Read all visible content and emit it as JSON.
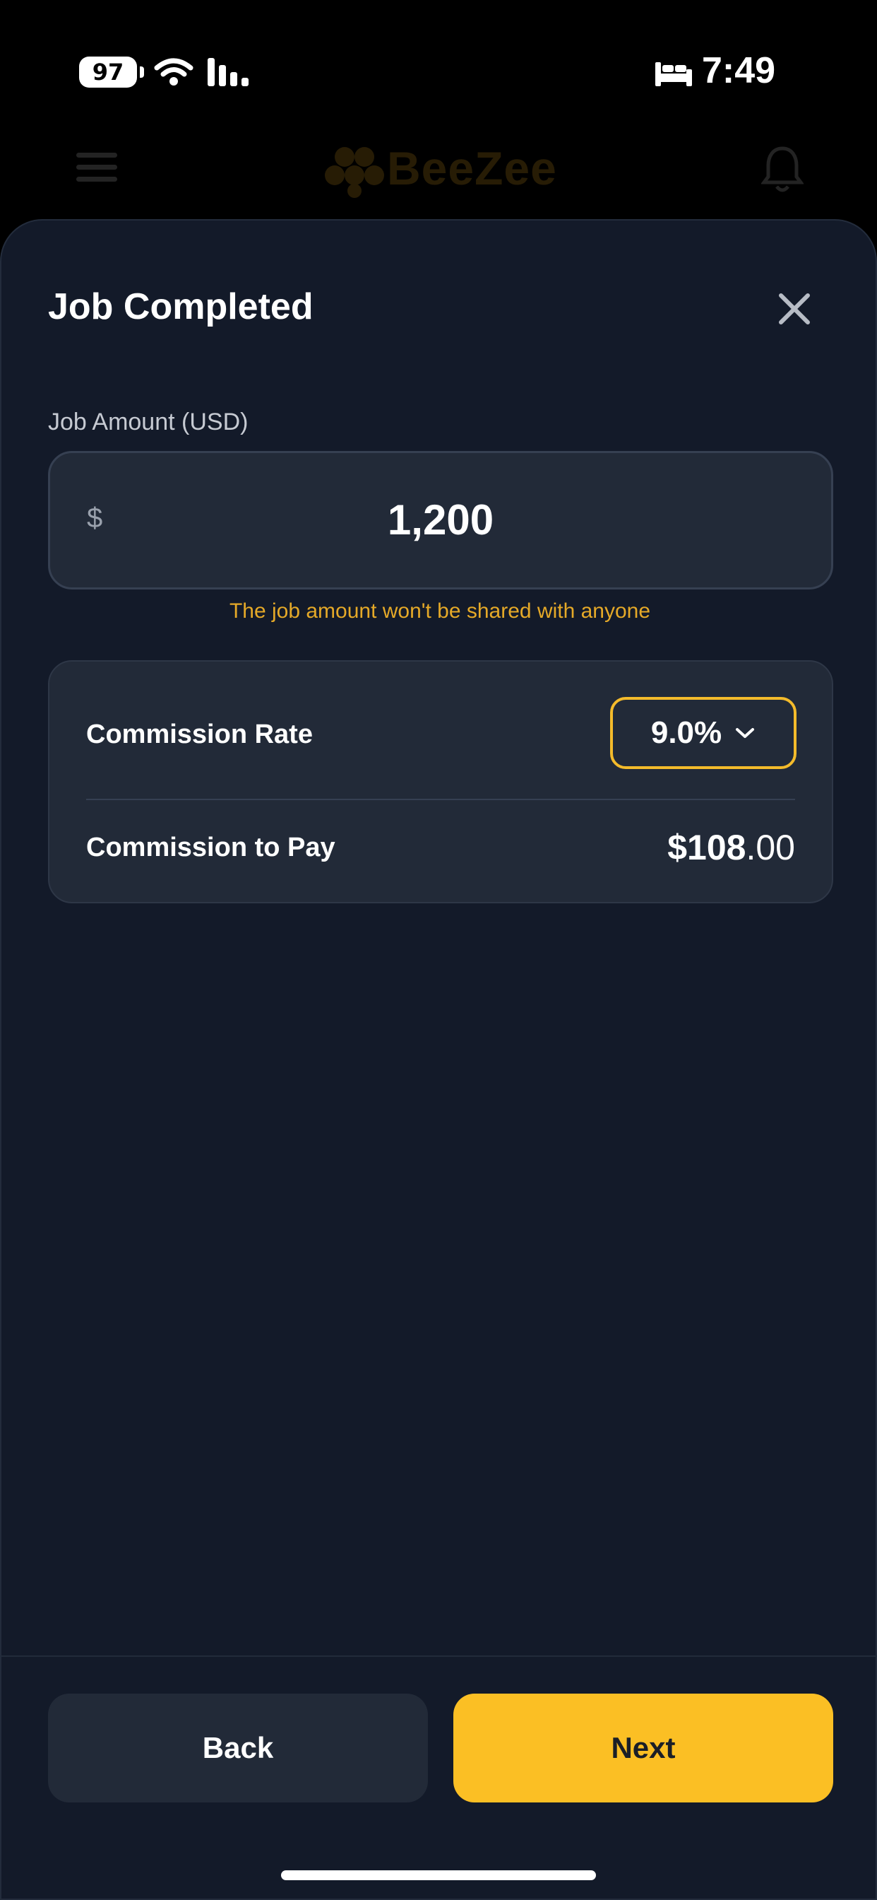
{
  "status_bar": {
    "battery_level": "97",
    "time": "7:49",
    "icons": [
      "wifi-icon",
      "signal-icon",
      "bed-icon"
    ]
  },
  "app_header": {
    "brand": "BeeZee",
    "icons": [
      "menu-icon",
      "logo-icon",
      "bell-icon"
    ]
  },
  "modal": {
    "title": "Job Completed",
    "close_icon": "close-icon",
    "job_amount": {
      "label": "Job Amount (USD)",
      "currency_symbol": "$",
      "value": "1,200",
      "note": "The job amount won't be shared with anyone"
    },
    "commission": {
      "rate_label": "Commission Rate",
      "rate_value": "9.0%",
      "pay_label": "Commission to Pay",
      "pay_value_main": "$108",
      "pay_value_cents": ".00"
    },
    "buttons": {
      "back": "Back",
      "next": "Next"
    }
  },
  "colors": {
    "accent": "#fbbf24",
    "sheet_background": "#131a29",
    "card_background": "#222a38",
    "note_text": "#e5a928"
  }
}
